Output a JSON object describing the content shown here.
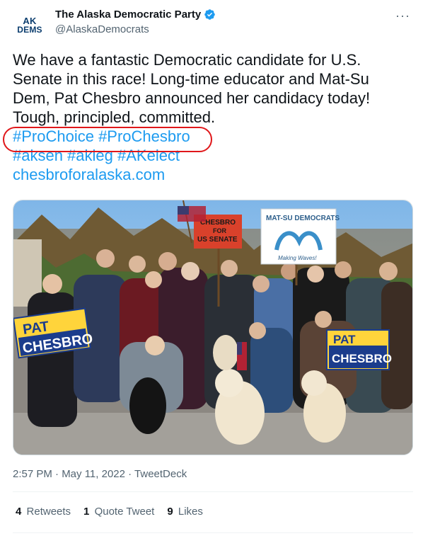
{
  "author": {
    "avatar_line1": "AK",
    "avatar_line2": "DEMS",
    "display_name": "The Alaska Democratic Party",
    "handle": "@AlaskaDemocrats",
    "verified": true
  },
  "more_label": "···",
  "tweet": {
    "lines": [
      "We have a fantastic Democratic candidate for U.S.",
      "Senate in this race! Long-time educator and Mat-Su",
      "Dem, Pat Chesbro announced her candidacy today!",
      "Tough, principled, committed."
    ],
    "hashtags_line1": "#ProChoice #ProChesbro",
    "hashtags_line2": "#aksen #akleg #AKelect",
    "link": "chesbroforalaska.com"
  },
  "photo": {
    "sign_left_line1": "PAT",
    "sign_left_line2": "CHESBRO",
    "sign_right_line1": "PAT",
    "sign_right_line2": "CHESBRO",
    "sign_red_line1": "CHESBRO",
    "sign_red_line2": "FOR",
    "sign_red_line3": "US SENATE",
    "sign_matsu_line1": "MAT-SU DEMOCRATS",
    "sign_matsu_line2": "Making Waves!"
  },
  "meta": {
    "timestamp": "2:57 PM · May 11, 2022 · TweetDeck"
  },
  "stats": {
    "retweets_count": "4",
    "retweets_label": "Retweets",
    "quotes_count": "1",
    "quotes_label": "Quote Tweet",
    "likes_count": "9",
    "likes_label": "Likes"
  },
  "colors": {
    "link": "#1d9bf0",
    "highlight_circle": "#e0171a",
    "muted_text": "#536471"
  }
}
